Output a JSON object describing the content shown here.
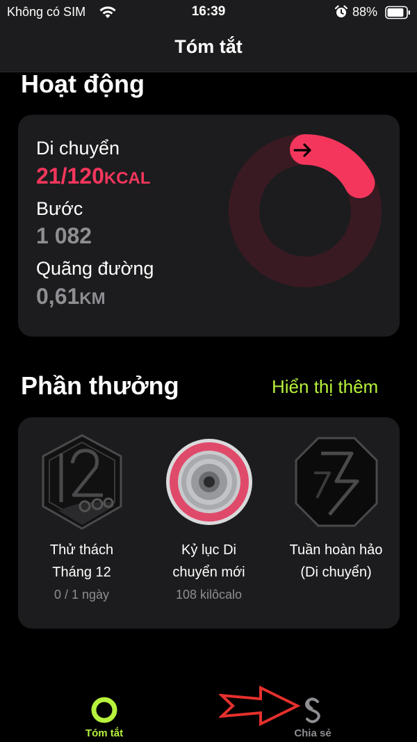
{
  "status_bar": {
    "carrier": "Không có SIM",
    "time": "16:39",
    "battery_percent": "88%",
    "battery_level": 0.88,
    "icons": [
      "wifi-icon",
      "alarm-icon",
      "battery-icon"
    ]
  },
  "nav": {
    "title": "Tóm tắt"
  },
  "activity": {
    "section_title": "Hoạt động",
    "move": {
      "label": "Di chuyển",
      "value": "21/120",
      "unit": "KCAL",
      "current": 21,
      "goal": 120
    },
    "steps": {
      "label": "Bước",
      "value": "1 082"
    },
    "distance": {
      "label": "Quãng đường",
      "value": "0,61",
      "unit": "KM"
    }
  },
  "awards": {
    "section_title": "Phần thưởng",
    "show_more": "Hiển thị thêm",
    "items": [
      {
        "name_line1": "Thử thách",
        "name_line2": "Tháng 12",
        "subtitle": "0 / 1 ngày",
        "icon": "december-challenge-badge-icon"
      },
      {
        "name_line1": "Kỷ lục Di",
        "name_line2": "chuyển mới",
        "subtitle": "108 kilôcalo",
        "icon": "move-record-medal-icon"
      },
      {
        "name_line1": "Tuần hoàn hảo",
        "name_line2": "(Di chuyển)",
        "subtitle": "",
        "icon": "perfect-week-badge-icon"
      }
    ]
  },
  "tabbar": {
    "tabs": [
      {
        "label": "Tóm tắt",
        "icon": "activity-ring-icon",
        "active": true
      },
      {
        "label": "Chia sẻ",
        "icon": "sharing-icon",
        "active": false
      }
    ]
  },
  "colors": {
    "move": "#f5365c",
    "accent_green": "#b7f23c",
    "secondary_text": "#8e8e93",
    "card_background": "#1c1c1e"
  }
}
